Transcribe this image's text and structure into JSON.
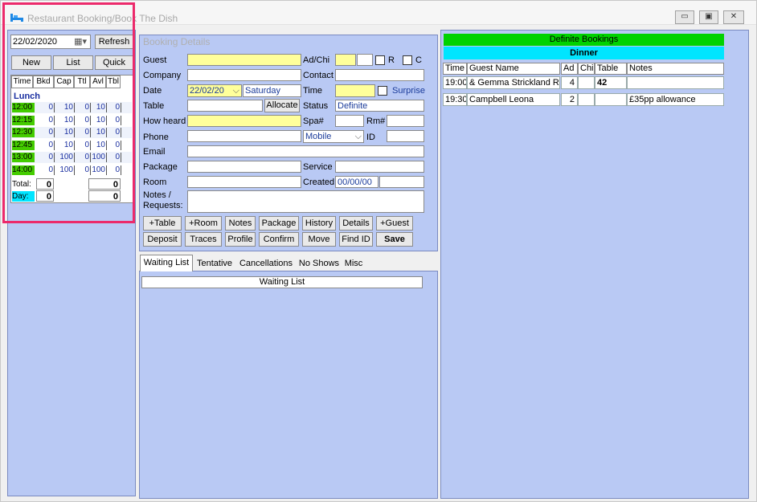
{
  "window": {
    "title": "Restaurant Booking/Book The Dish",
    "minimize": "▭",
    "maximize": "▣",
    "close": "✕"
  },
  "left": {
    "date": "22/02/2020",
    "refresh": "Refresh",
    "buttons": {
      "new": "New",
      "list": "List",
      "quick": "Quick"
    },
    "headers": [
      "Time",
      "Bkd",
      "Cap",
      "Ttl",
      "Avl",
      "Tbl"
    ],
    "section": "Lunch",
    "rows": [
      {
        "time": "12:00",
        "bkd": "0",
        "cap": "10",
        "ttl": "0",
        "avl": "10",
        "tbl": "0"
      },
      {
        "time": "12:15",
        "bkd": "0",
        "cap": "10",
        "ttl": "0",
        "avl": "10",
        "tbl": "0"
      },
      {
        "time": "12:30",
        "bkd": "0",
        "cap": "10",
        "ttl": "0",
        "avl": "10",
        "tbl": "0"
      },
      {
        "time": "12:45",
        "bkd": "0",
        "cap": "10",
        "ttl": "0",
        "avl": "10",
        "tbl": "0"
      },
      {
        "time": "13:00",
        "bkd": "0",
        "cap": "100",
        "ttl": "0",
        "avl": "100",
        "tbl": "0"
      },
      {
        "time": "14:00",
        "bkd": "0",
        "cap": "100",
        "ttl": "0",
        "avl": "100",
        "tbl": "0"
      }
    ],
    "total_label": "Total:",
    "total_value": "0",
    "total_right": "0",
    "day_label": "Day:",
    "day_value": "0",
    "day_right": "0"
  },
  "booking": {
    "title": "Booking Details",
    "guest": "Guest",
    "adchi": "Ad/Chi",
    "r": "R",
    "c": "C",
    "company": "Company",
    "contact": "Contact",
    "date_label": "Date",
    "date_value": "22/02/20",
    "day_value": "Saturday",
    "time_label": "Time",
    "surprise": "Surprise",
    "table": "Table",
    "allocate": "Allocate",
    "status_label": "Status",
    "status_value": "Definite",
    "how_heard": "How heard",
    "spa": "Spa#",
    "rm": "Rm#",
    "phone": "Phone",
    "mobile": "Mobile",
    "id": "ID",
    "email": "Email",
    "package": "Package",
    "service": "Service",
    "room": "Room",
    "created_label": "Created",
    "created_value": "00/00/00",
    "notes": "Notes /\nRequests:",
    "row1": [
      "+Table",
      "+Room",
      "Notes",
      "Package",
      "History",
      "Details",
      "+Guest"
    ],
    "row2": [
      "Deposit",
      "Traces",
      "Profile",
      "Confirm",
      "Move",
      "Find ID",
      "Save"
    ]
  },
  "tabs": {
    "items": [
      "Waiting List",
      "Tentative",
      "Cancellations",
      "No Shows",
      "Misc"
    ],
    "header": "Waiting List"
  },
  "right": {
    "banner": "Definite Bookings",
    "meal": "Dinner",
    "headers": [
      "Time",
      "Guest Name",
      "Ad",
      "Chi",
      "Table",
      "Notes"
    ],
    "rows": [
      {
        "time": "19:00",
        "guest": "& Gemma Strickland Rich",
        "ad": "4",
        "chi": "",
        "table": "42",
        "notes": ""
      },
      {
        "time": "19:30",
        "guest": "Campbell Leona",
        "ad": "2",
        "chi": "",
        "table": "",
        "notes": "£35pp allowance"
      }
    ]
  },
  "colors": {
    "panel": "#b9c9f4",
    "highlight": "#ec2a6b",
    "time_green": "#44cc00",
    "banner_green": "#00d200",
    "meal_cyan": "#00e5ff",
    "field_yellow": "#ffff9b"
  }
}
